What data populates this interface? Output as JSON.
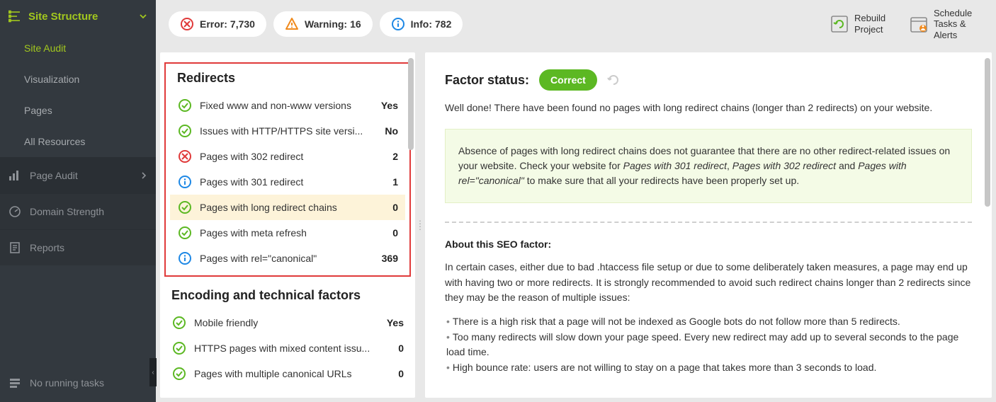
{
  "sidebar": {
    "header": "Site Structure",
    "items": [
      {
        "label": "Site Audit"
      },
      {
        "label": "Visualization"
      },
      {
        "label": "Pages"
      },
      {
        "label": "All Resources"
      }
    ],
    "sections": [
      {
        "label": "Page Audit"
      },
      {
        "label": "Domain Strength"
      },
      {
        "label": "Reports"
      }
    ],
    "running": "No running tasks"
  },
  "topbar": {
    "error_label": "Error:",
    "error_value": "7,730",
    "warning_label": "Warning:",
    "warning_value": "16",
    "info_label": "Info:",
    "info_value": "782",
    "rebuild": "Rebuild Project",
    "schedule": "Schedule Tasks & Alerts"
  },
  "list": {
    "redirects_title": "Redirects",
    "redirects": [
      {
        "icon": "ok",
        "label": "Fixed www and non-www versions",
        "value": "Yes"
      },
      {
        "icon": "ok",
        "label": "Issues with HTTP/HTTPS site versi...",
        "value": "No"
      },
      {
        "icon": "error",
        "label": "Pages with 302 redirect",
        "value": "2"
      },
      {
        "icon": "info",
        "label": "Pages with 301 redirect",
        "value": "1"
      },
      {
        "icon": "ok",
        "label": "Pages with long redirect chains",
        "value": "0"
      },
      {
        "icon": "ok",
        "label": "Pages with meta refresh",
        "value": "0"
      },
      {
        "icon": "info",
        "label": "Pages with rel=\"canonical\"",
        "value": "369"
      }
    ],
    "encoding_title": "Encoding and technical factors",
    "encoding": [
      {
        "icon": "ok",
        "label": "Mobile friendly",
        "value": "Yes"
      },
      {
        "icon": "ok",
        "label": "HTTPS pages with mixed content issu...",
        "value": "0"
      },
      {
        "icon": "ok",
        "label": "Pages with multiple canonical URLs",
        "value": "0"
      }
    ]
  },
  "detail": {
    "status_label": "Factor status:",
    "status_value": "Correct",
    "welldone": "Well done! There have been found no pages with long redirect chains (longer than 2 redirects) on your website.",
    "note_pre": "Absence of pages with long redirect chains does not guarantee that there are no other redirect-related issues on your website. Check your website for ",
    "note_em1": "Pages with 301 redirect",
    "note_mid1": ", ",
    "note_em2": "Pages with 302 redirect",
    "note_mid2": " and ",
    "note_em3": "Pages with rel=\"canonical\"",
    "note_post": "  to make sure that all your redirects have been properly set up.",
    "about_title": "About this SEO factor:",
    "about_p1": "In certain cases, either due to bad .htaccess file setup or due to some deliberately taken measures, a page may end up with having two or more redirects. It is strongly recommended to avoid such redirect chains longer than 2 redirects since they may be the reason of multiple issues:",
    "bullets": [
      "There is a high risk that a page will not be indexed as Google bots do not follow more than 5 redirects.",
      "Too many redirects will slow down your page speed. Every new redirect may add up to several seconds to the page load time.",
      "High bounce rate: users are not willing to stay on a page that takes more than 3 seconds to load."
    ]
  }
}
